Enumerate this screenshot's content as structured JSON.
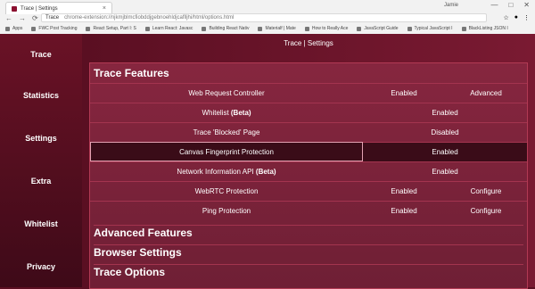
{
  "browser": {
    "tab_title": "Trace | Settings",
    "tab_close": "×",
    "user_name": "Jamie",
    "window_controls": {
      "minimize": "—",
      "maximize": "□",
      "close": "✕"
    },
    "nav": {
      "back": "←",
      "forward": "→",
      "reload": "⟳"
    },
    "omnibox": {
      "site": "Trace",
      "url": "chrome-extension://njkmjblmcfiobddjgebnoehldjcaflljhi/html/options.html"
    },
    "bookmarks": [
      "Apps",
      "FWC Post Tracking",
      "React Setup, Part I: S",
      "Learn React: Javasc",
      "Building React Nativ",
      "Materialf | Mate",
      "How to Really Ace",
      "JavaScript Guide",
      "Typical JavaScript I",
      "BlackListing JSON I"
    ]
  },
  "sidebar": {
    "items": [
      "Trace",
      "Statistics",
      "Settings",
      "Extra",
      "Whitelist",
      "Privacy"
    ]
  },
  "main": {
    "title": "Trace | Settings",
    "sections": {
      "trace_features": "Trace Features",
      "advanced_features": "Advanced Features",
      "browser_settings": "Browser Settings",
      "trace_options": "Trace Options"
    },
    "rows": [
      {
        "label": "Web Request Controller",
        "beta": "",
        "status": "Enabled",
        "action": "Advanced"
      },
      {
        "label": "Whitelist ",
        "beta": "(Beta)",
        "status": "Enabled",
        "action": ""
      },
      {
        "label": "Trace 'Blocked' Page",
        "beta": "",
        "status": "Disabled",
        "action": ""
      },
      {
        "label": "Canvas Fingerprint Protection",
        "beta": "",
        "status": "Enabled",
        "action": ""
      },
      {
        "label": "Network Information API ",
        "beta": "(Beta)",
        "status": "Enabled",
        "action": ""
      },
      {
        "label": "WebRTC Protection",
        "beta": "",
        "status": "Enabled",
        "action": "Configure"
      },
      {
        "label": "Ping Protection",
        "beta": "",
        "status": "Enabled",
        "action": "Configure"
      }
    ]
  },
  "colors": {
    "brand": "#5a0f22",
    "panel": "#86263f",
    "row_selected": "#3a0c18"
  }
}
